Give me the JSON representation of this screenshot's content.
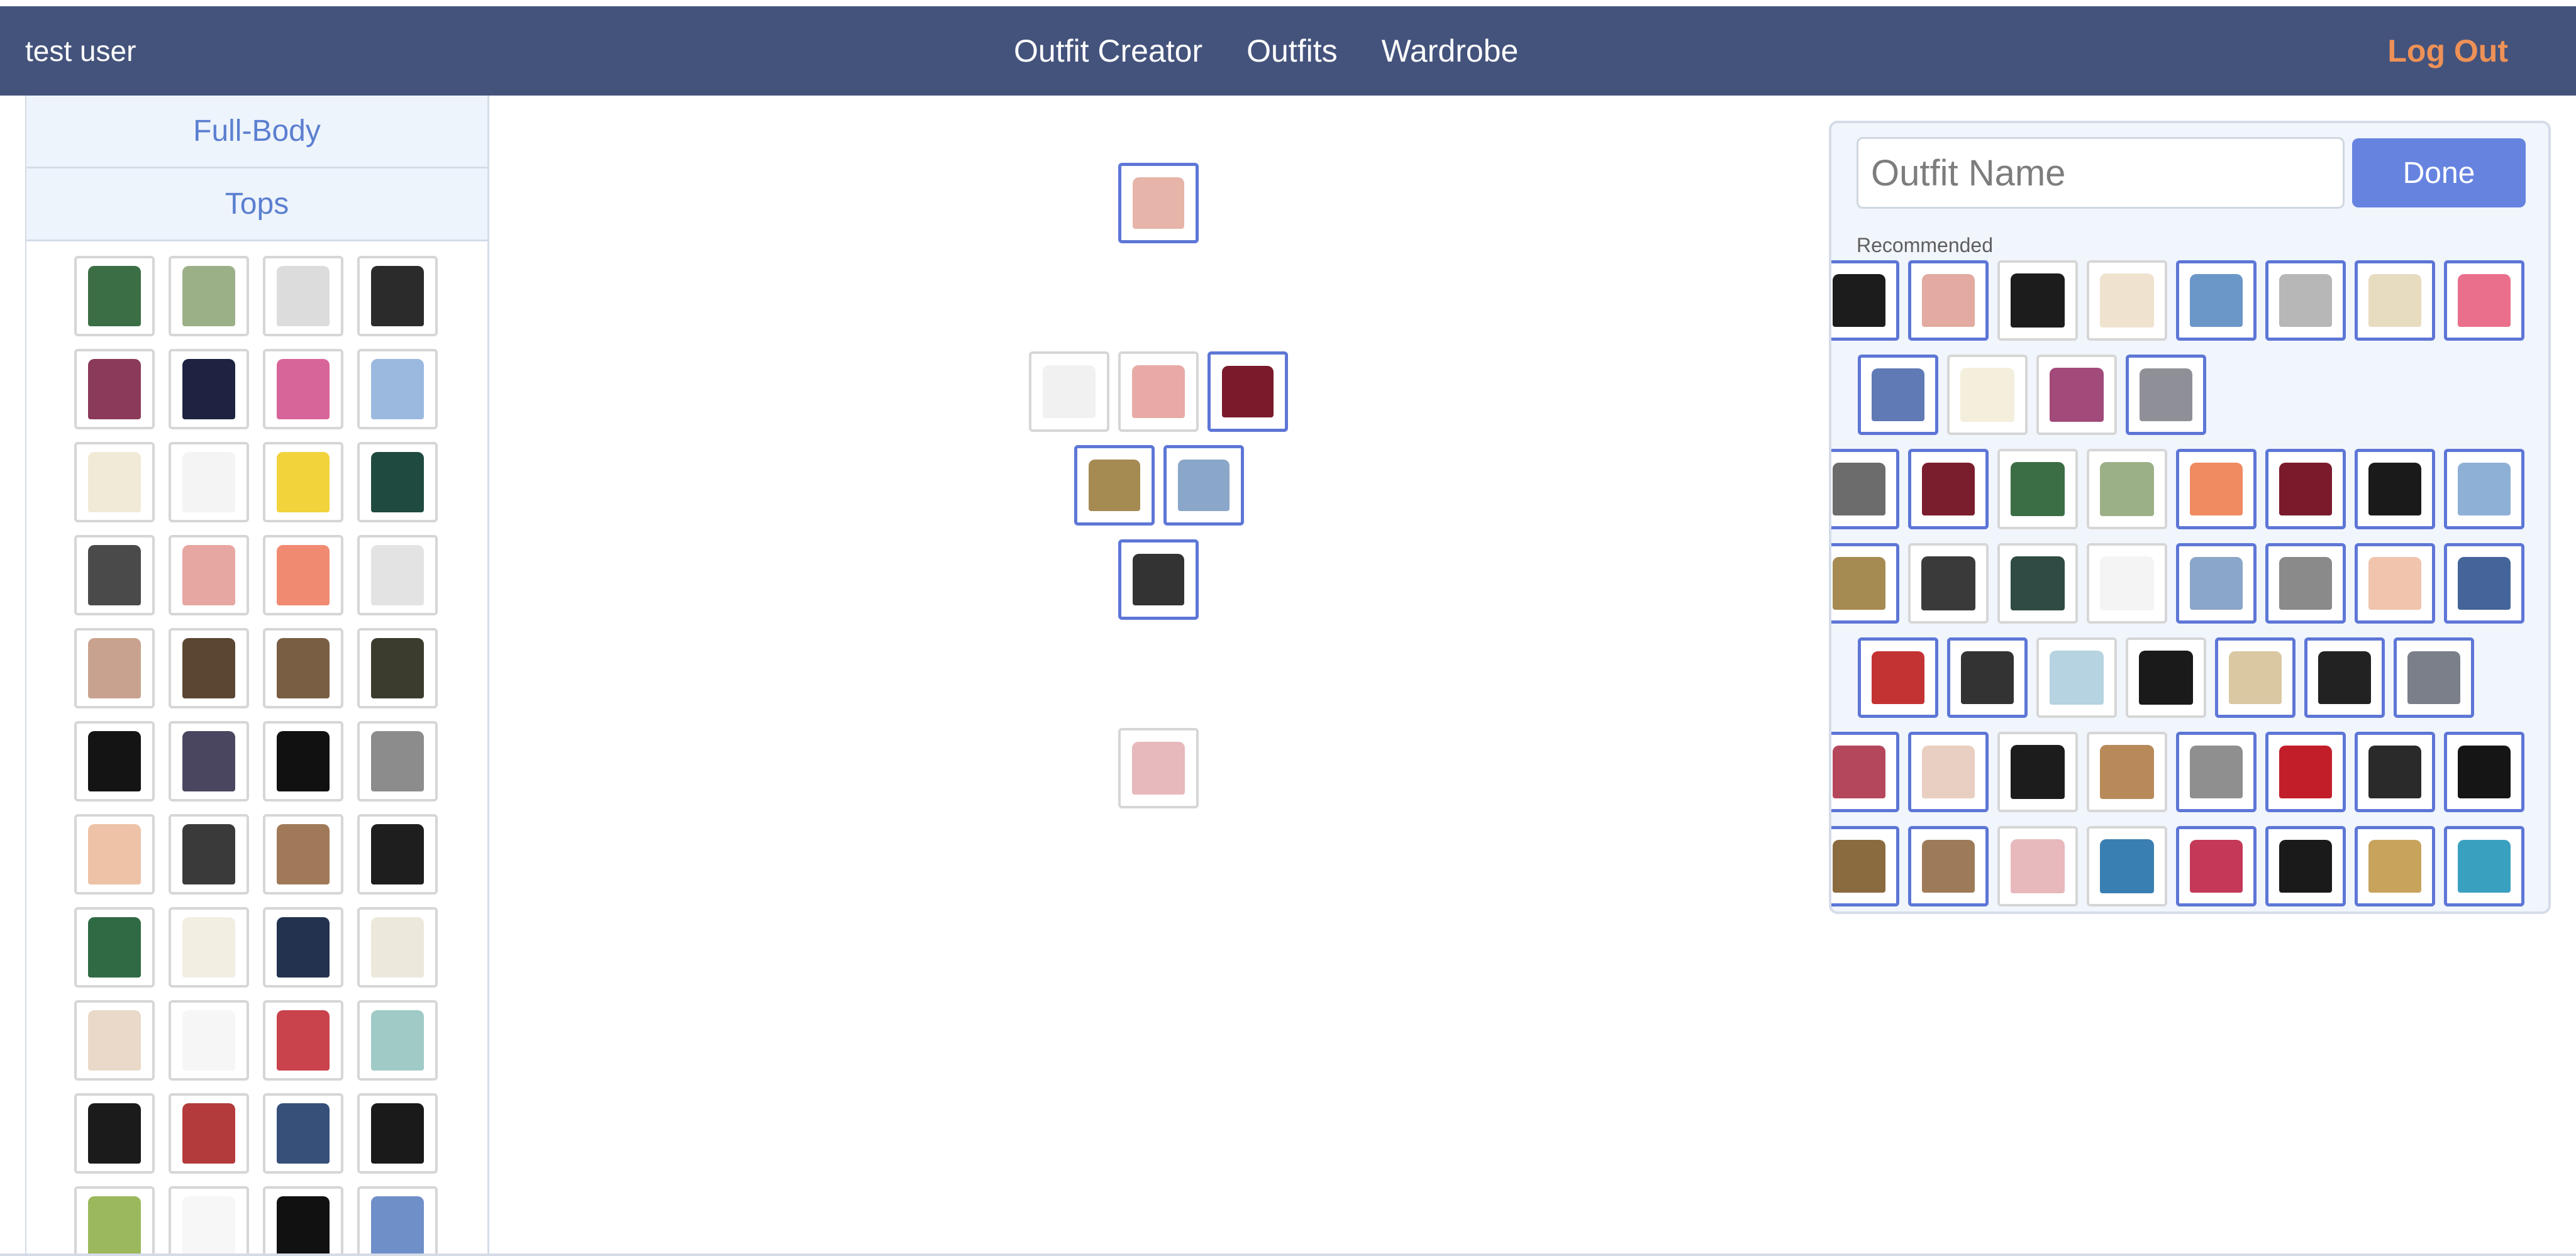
{
  "navbar": {
    "user": "test user",
    "links": [
      "Outfit Creator",
      "Outfits",
      "Wardrobe"
    ],
    "logout": "Log Out"
  },
  "sidebar": {
    "categories": [
      "Full-Body",
      "Tops"
    ],
    "thumbnails": [
      {
        "color": "#3c6e45"
      },
      {
        "color": "#9cb088"
      },
      {
        "color": "#dcdcdc"
      },
      {
        "color": "#2b2b2b"
      },
      {
        "color": "#8b3a5a"
      },
      {
        "color": "#1d2340"
      },
      {
        "color": "#d8659a"
      },
      {
        "color": "#9bb9df"
      },
      {
        "color": "#f1ead7"
      },
      {
        "color": "#f4f4f4"
      },
      {
        "color": "#f2d33b"
      },
      {
        "color": "#1f4a40"
      },
      {
        "color": "#4a4a4a"
      },
      {
        "color": "#e6a6a2"
      },
      {
        "color": "#f08a70"
      },
      {
        "color": "#e3e3e3"
      },
      {
        "color": "#c9a28f"
      },
      {
        "color": "#5a4632"
      },
      {
        "color": "#7a5e44"
      },
      {
        "color": "#3b3b2e"
      },
      {
        "color": "#141414"
      },
      {
        "color": "#4b4660"
      },
      {
        "color": "#111111"
      },
      {
        "color": "#8c8c8c"
      },
      {
        "color": "#edc2a6"
      },
      {
        "color": "#3a3a3a"
      },
      {
        "color": "#a07a58"
      },
      {
        "color": "#1e1e1e"
      },
      {
        "color": "#2f6a45"
      },
      {
        "color": "#f2eee2"
      },
      {
        "color": "#22324f"
      },
      {
        "color": "#ece8dc"
      },
      {
        "color": "#ead9c8"
      },
      {
        "color": "#f6f6f6"
      },
      {
        "color": "#c9434c"
      },
      {
        "color": "#9fcac6"
      },
      {
        "color": "#1b1b1b"
      },
      {
        "color": "#b33b3b"
      },
      {
        "color": "#36507a"
      },
      {
        "color": "#1a1a1a"
      },
      {
        "color": "#9cb85c"
      },
      {
        "color": "#f7f7f7"
      },
      {
        "color": "#111111"
      },
      {
        "color": "#6f8fc8"
      }
    ]
  },
  "canvas": {
    "items": [
      {
        "color": "#e6b4a8",
        "selected": true
      },
      {
        "color": "#f1f1f1",
        "selected": false
      },
      {
        "color": "#e8aaa6",
        "selected": false
      },
      {
        "color": "#7a1a2a",
        "selected": true
      },
      {
        "color": "#a58a52",
        "selected": true
      },
      {
        "color": "#8aa6c8",
        "selected": true
      },
      {
        "color": "#333333",
        "selected": true
      },
      {
        "color": "#e7b9bc",
        "selected": false
      }
    ]
  },
  "panel": {
    "name_placeholder": "Outfit Name",
    "done_label": "Done",
    "recommended_label": "Recommended",
    "rows": [
      [
        {
          "color": "#1c1c1c",
          "selected": true
        },
        {
          "color": "#e2aaa0",
          "selected": true
        },
        {
          "color": "#1c1c1c",
          "selected": false
        },
        {
          "color": "#efe3cf",
          "selected": false
        },
        {
          "color": "#6b97c8",
          "selected": true
        },
        {
          "color": "#b7b7b7",
          "selected": true
        },
        {
          "color": "#e8dcc0",
          "selected": true
        },
        {
          "color": "#ea6f8c",
          "selected": true
        }
      ],
      [
        {
          "color": "#5f7ab5",
          "selected": true
        },
        {
          "color": "#f4efdc",
          "selected": false
        },
        {
          "color": "#a24a7a",
          "selected": false
        },
        {
          "color": "#8f8f97",
          "selected": true
        }
      ],
      [
        {
          "color": "#6c6c6c",
          "selected": true
        },
        {
          "color": "#7a1d2c",
          "selected": true
        },
        {
          "color": "#3c6e45",
          "selected": false
        },
        {
          "color": "#9cb088",
          "selected": false
        },
        {
          "color": "#f08a60",
          "selected": true
        },
        {
          "color": "#7a1a2a",
          "selected": true
        },
        {
          "color": "#1a1a1a",
          "selected": true
        },
        {
          "color": "#8fb0d6",
          "selected": true
        }
      ],
      [
        {
          "color": "#a58a52",
          "selected": true
        },
        {
          "color": "#3a3a3a",
          "selected": false
        },
        {
          "color": "#2f4b44",
          "selected": false
        },
        {
          "color": "#f4f4f4",
          "selected": false
        },
        {
          "color": "#8aa6c8",
          "selected": true
        },
        {
          "color": "#8a8a8a",
          "selected": true
        },
        {
          "color": "#f0c4ad",
          "selected": true
        },
        {
          "color": "#45659a",
          "selected": true
        }
      ],
      [
        {
          "color": "#c43333",
          "selected": true
        },
        {
          "color": "#333333",
          "selected": true
        },
        {
          "color": "#b5d3e0",
          "selected": false
        },
        {
          "color": "#1a1a1a",
          "selected": false
        },
        {
          "color": "#d9c8a2",
          "selected": true
        },
        {
          "color": "#222222",
          "selected": true
        },
        {
          "color": "#7a7f8a",
          "selected": true
        }
      ],
      [
        {
          "color": "#b5475c",
          "selected": true
        },
        {
          "color": "#e9cfc1",
          "selected": true
        },
        {
          "color": "#1c1c1c",
          "selected": false
        },
        {
          "color": "#b88a5a",
          "selected": false
        },
        {
          "color": "#8f8f8f",
          "selected": true
        },
        {
          "color": "#c21e2a",
          "selected": true
        },
        {
          "color": "#2a2a2a",
          "selected": true
        },
        {
          "color": "#151515",
          "selected": true
        }
      ],
      [
        {
          "color": "#8a6a3f",
          "selected": true
        },
        {
          "color": "#9d7a58",
          "selected": true
        },
        {
          "color": "#e7b9bc",
          "selected": false
        },
        {
          "color": "#3a7fb1",
          "selected": false
        },
        {
          "color": "#c43858",
          "selected": true
        },
        {
          "color": "#1a1a1a",
          "selected": true
        },
        {
          "color": "#c7a35c",
          "selected": true
        },
        {
          "color": "#3aa0c0",
          "selected": true
        }
      ]
    ]
  }
}
